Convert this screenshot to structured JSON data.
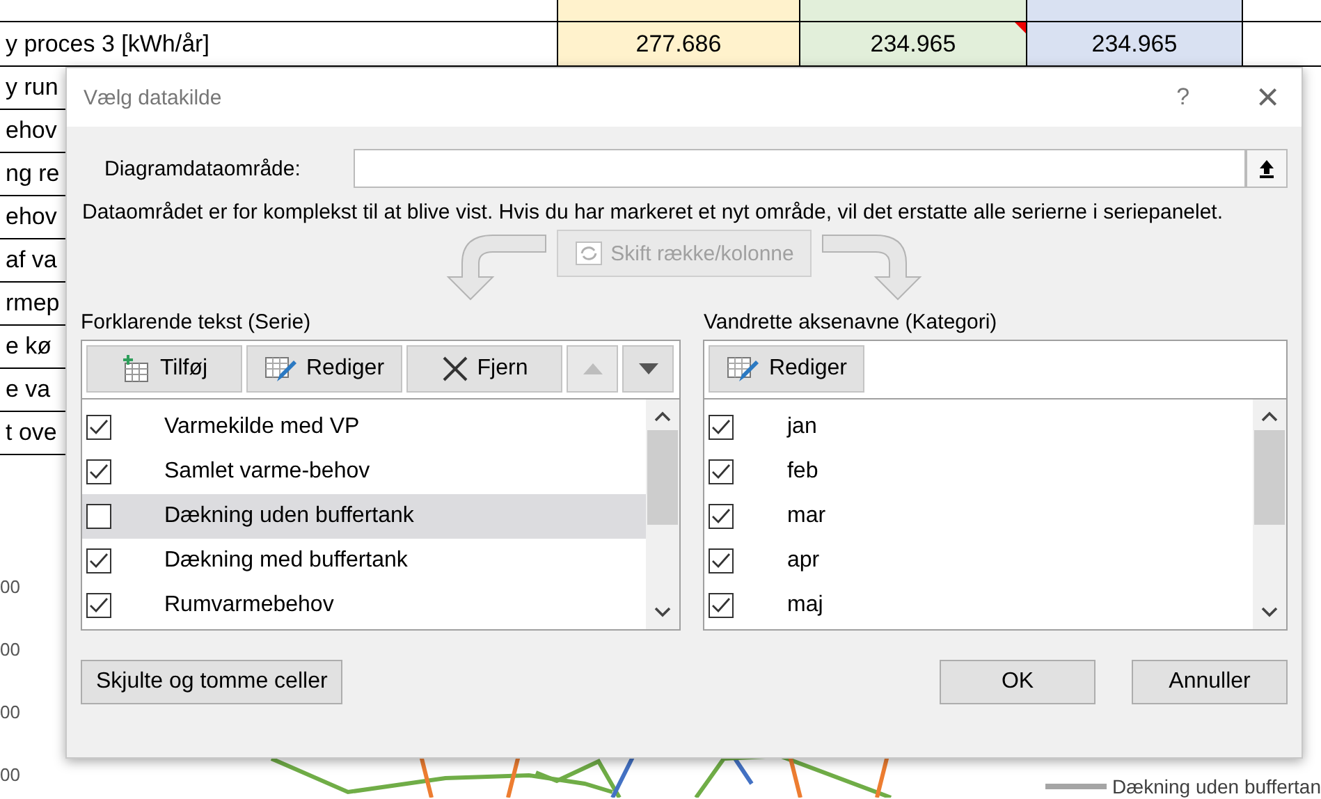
{
  "spreadsheet": {
    "row_label": "y proces 3 [kWh/år]",
    "cells": [
      {
        "text": "277.686",
        "color": "#fff2cc",
        "has_comment": false
      },
      {
        "text": "234.965",
        "color": "#e2efda",
        "has_comment": true
      },
      {
        "text": "234.965",
        "color": "#d9e1f2",
        "has_comment": false
      }
    ],
    "row_labels": [
      "y run",
      "ehov",
      "ng re",
      "ehov",
      "af va",
      "rmep",
      "e kø",
      "e va",
      "t ove"
    ],
    "axis_labels": [
      "00",
      "00",
      "00",
      "00"
    ],
    "legend": "Dækning uden buffertan"
  },
  "dialog": {
    "title": "Vælg datakilde",
    "help": "?",
    "close": "×",
    "data_range": {
      "label": "Diagramdataområde:"
    },
    "message": "Dataområdet er for komplekst til at blive vist. Hvis du har markeret et nyt område, vil det erstatte alle serierne i seriepanelet.",
    "switch_button": {
      "label": "Skift række/kolonne",
      "disabled": true
    },
    "series": {
      "title": "Forklarende tekst (Serie)",
      "buttons": [
        {
          "label": "Tilføj",
          "kind": "add"
        },
        {
          "label": "Rediger",
          "kind": "edit"
        },
        {
          "label": "Fjern",
          "kind": "remove"
        },
        {
          "kind": "up",
          "disabled": true
        },
        {
          "kind": "down",
          "disabled": false
        }
      ],
      "items": [
        {
          "label": "Varmekilde med VP",
          "checked": true,
          "selected": false
        },
        {
          "label": "Samlet varme-behov",
          "checked": true,
          "selected": false
        },
        {
          "label": "Dækning uden buffertank",
          "checked": false,
          "selected": true
        },
        {
          "label": "Dækning med buffertank",
          "checked": true,
          "selected": false
        },
        {
          "label": "Rumvarmebehov",
          "checked": true,
          "selected": false
        }
      ]
    },
    "categories": {
      "title": "Vandrette aksenavne (Kategori)",
      "buttons": [
        {
          "label": "Rediger",
          "kind": "edit"
        }
      ],
      "items": [
        {
          "label": "jan",
          "checked": true,
          "selected": false
        },
        {
          "label": "feb",
          "checked": true,
          "selected": false
        },
        {
          "label": "mar",
          "checked": true,
          "selected": false
        },
        {
          "label": "apr",
          "checked": true,
          "selected": false
        },
        {
          "label": "maj",
          "checked": true,
          "selected": false
        }
      ]
    },
    "hidden_cells_button": "Skjulte og tomme celler",
    "ok_button": "OK",
    "cancel_button": "Annuller"
  }
}
